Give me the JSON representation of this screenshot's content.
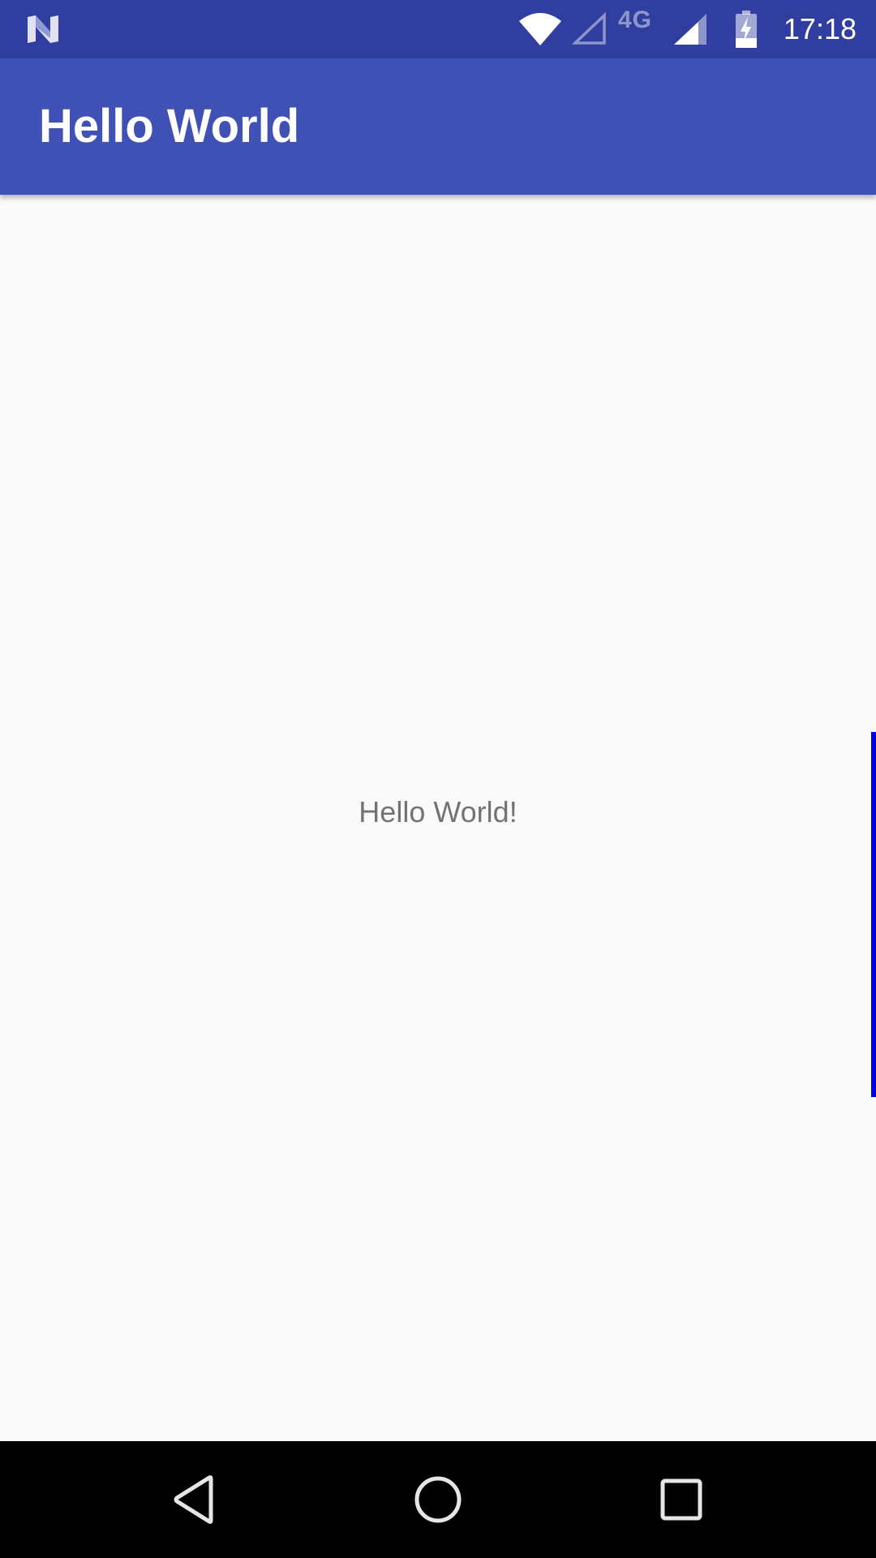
{
  "status_bar": {
    "network_type": "4G",
    "time": "17:18",
    "icons": {
      "notification": "n-notification-icon",
      "wifi": "wifi-icon",
      "sim2_signal": "empty-signal-icon",
      "signal": "cell-signal-icon",
      "battery": "battery-charging-icon"
    }
  },
  "app_bar": {
    "title": "Hello World"
  },
  "main": {
    "text": "Hello World!"
  },
  "nav_bar": {
    "back": "back-triangle-icon",
    "home": "home-circle-icon",
    "recents": "recents-square-icon"
  },
  "colors": {
    "status_bar": "#303f9f",
    "primary": "#3f51b5",
    "background": "#fafafa",
    "text": "#737373",
    "scroll_indicator": "#0000dd",
    "nav_bar": "#000000"
  }
}
